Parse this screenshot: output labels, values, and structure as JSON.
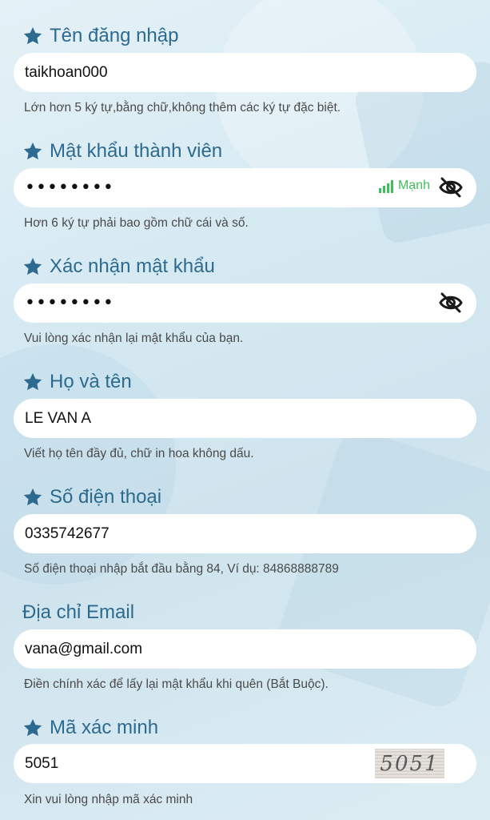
{
  "fields": [
    {
      "label": "Tên đăng nhập",
      "value": "taikhoan000",
      "hint": "Lớn hơn 5 ký tự,bằng chữ,không thêm các ký tự đặc biệt."
    },
    {
      "label": "Mật khẩu thành viên",
      "value": "••••••••",
      "strength_label": "Mạnh",
      "hint": "Hơn 6 ký tự phải bao gồm chữ cái và số."
    },
    {
      "label": "Xác nhận mật khẩu",
      "value": "••••••••",
      "hint": "Vui lòng xác nhận lại mật khẩu của bạn."
    },
    {
      "label": "Họ và tên",
      "value": "LE VAN A",
      "hint": "Viết họ tên đầy đủ, chữ in hoa không dấu."
    },
    {
      "label": "Số điện thoại",
      "value": "0335742677",
      "hint": "Số điện thoại nhập bắt đầu bằng 84, Ví dụ: 84868888789"
    },
    {
      "label": "Địa chỉ Email",
      "value": "vana@gmail.com",
      "hint": "Điền chính xác để lấy lại mật khẩu khi quên (Bắt Buộc)."
    },
    {
      "label": "Mã xác minh",
      "value": "5051",
      "captcha_text": "5051",
      "hint": "Xin vui lòng nhập mã xác minh"
    }
  ],
  "colors": {
    "label": "#2c6a8f",
    "strength": "#3fbf5a",
    "input_bg": "#ffffff",
    "hint": "#4a4a4a"
  },
  "icons": {
    "required": "star-icon",
    "toggle_visibility": "eye-slash-icon",
    "strength": "signal-bars-icon"
  }
}
